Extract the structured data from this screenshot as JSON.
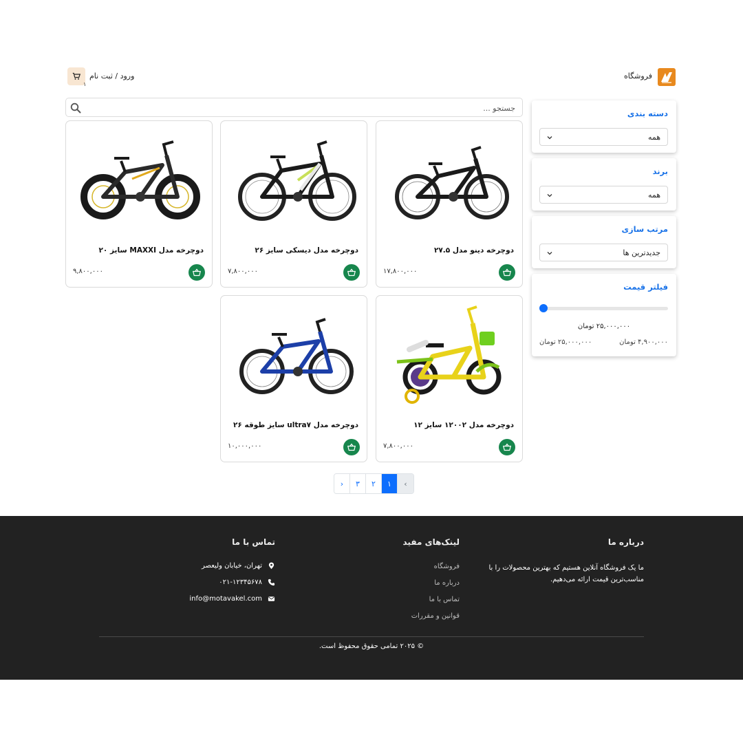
{
  "header": {
    "store_name": "فروشگاه",
    "login_label": "ورود / ثبت نام",
    "cart_count": "۱"
  },
  "search": {
    "placeholder": "جستجو ..."
  },
  "filters": {
    "category": {
      "title": "دسته بندی",
      "value": "همه"
    },
    "brand": {
      "title": "برند",
      "value": "همه"
    },
    "sort": {
      "title": "مرتب سازی",
      "value": "جدیدترین ها"
    },
    "price": {
      "title": "فیلتر قیمت",
      "current": "۲۵,۰۰۰,۰۰۰ تومان",
      "min": "۴,۹۰۰,۰۰۰ تومان",
      "max": "۲۵,۰۰۰,۰۰۰ تومان",
      "slider_fraction": 0
    }
  },
  "products": [
    {
      "title": "دوچرخه دینو مدل ۲۷.۵",
      "price": "۱۷,۸۰۰,۰۰۰",
      "image": "black-mountain-bike"
    },
    {
      "title": "دوچرخه مدل دیسکی سایز ۲۶",
      "price": "۷,۸۰۰,۰۰۰",
      "image": "black-white-mountain-bike"
    },
    {
      "title": "دوچرخه مدل MAXXI سایز ۲۰",
      "price": "۹,۸۰۰,۰۰۰",
      "image": "fat-tire-bike"
    },
    {
      "title": "دوچرخه مدل ۱۲۰۰۲ سایز ۱۲",
      "price": "۷,۸۰۰,۰۰۰",
      "image": "yellow-kids-bike"
    },
    {
      "title": "دوچرخه مدل ultra۷ سایز طوقه ۲۶",
      "price": "۱۰,۰۰۰,۰۰۰",
      "image": "blue-mountain-bike"
    }
  ],
  "pagination": {
    "prev": "‹",
    "pages": [
      "۱",
      "۲",
      "۳"
    ],
    "next": "›",
    "active": "۱"
  },
  "footer": {
    "about": {
      "title": "درباره ما",
      "text": "ما یک فروشگاه آنلاین هستیم که بهترین محصولات را با مناسب‌ترین قیمت ارائه می‌دهیم."
    },
    "links": {
      "title": "لینک‌های مفید",
      "items": [
        "فروشگاه",
        "درباره ما",
        "تماس با ما",
        "قوانین و مقررات"
      ]
    },
    "contact": {
      "title": "تماس با ما",
      "address": "تهران، خیابان ولیعصر",
      "phone": "۰۲۱-۱۲۳۴۵۶۷۸",
      "email": "info@motavakel.com"
    },
    "copyright": "© ۲۰۲۵ تمامی حقوق محفوظ است."
  },
  "colors": {
    "accent": "#0d6efd",
    "cart_green": "#17864d",
    "logo_orange": "#e8891e",
    "footer_bg": "#222222"
  }
}
